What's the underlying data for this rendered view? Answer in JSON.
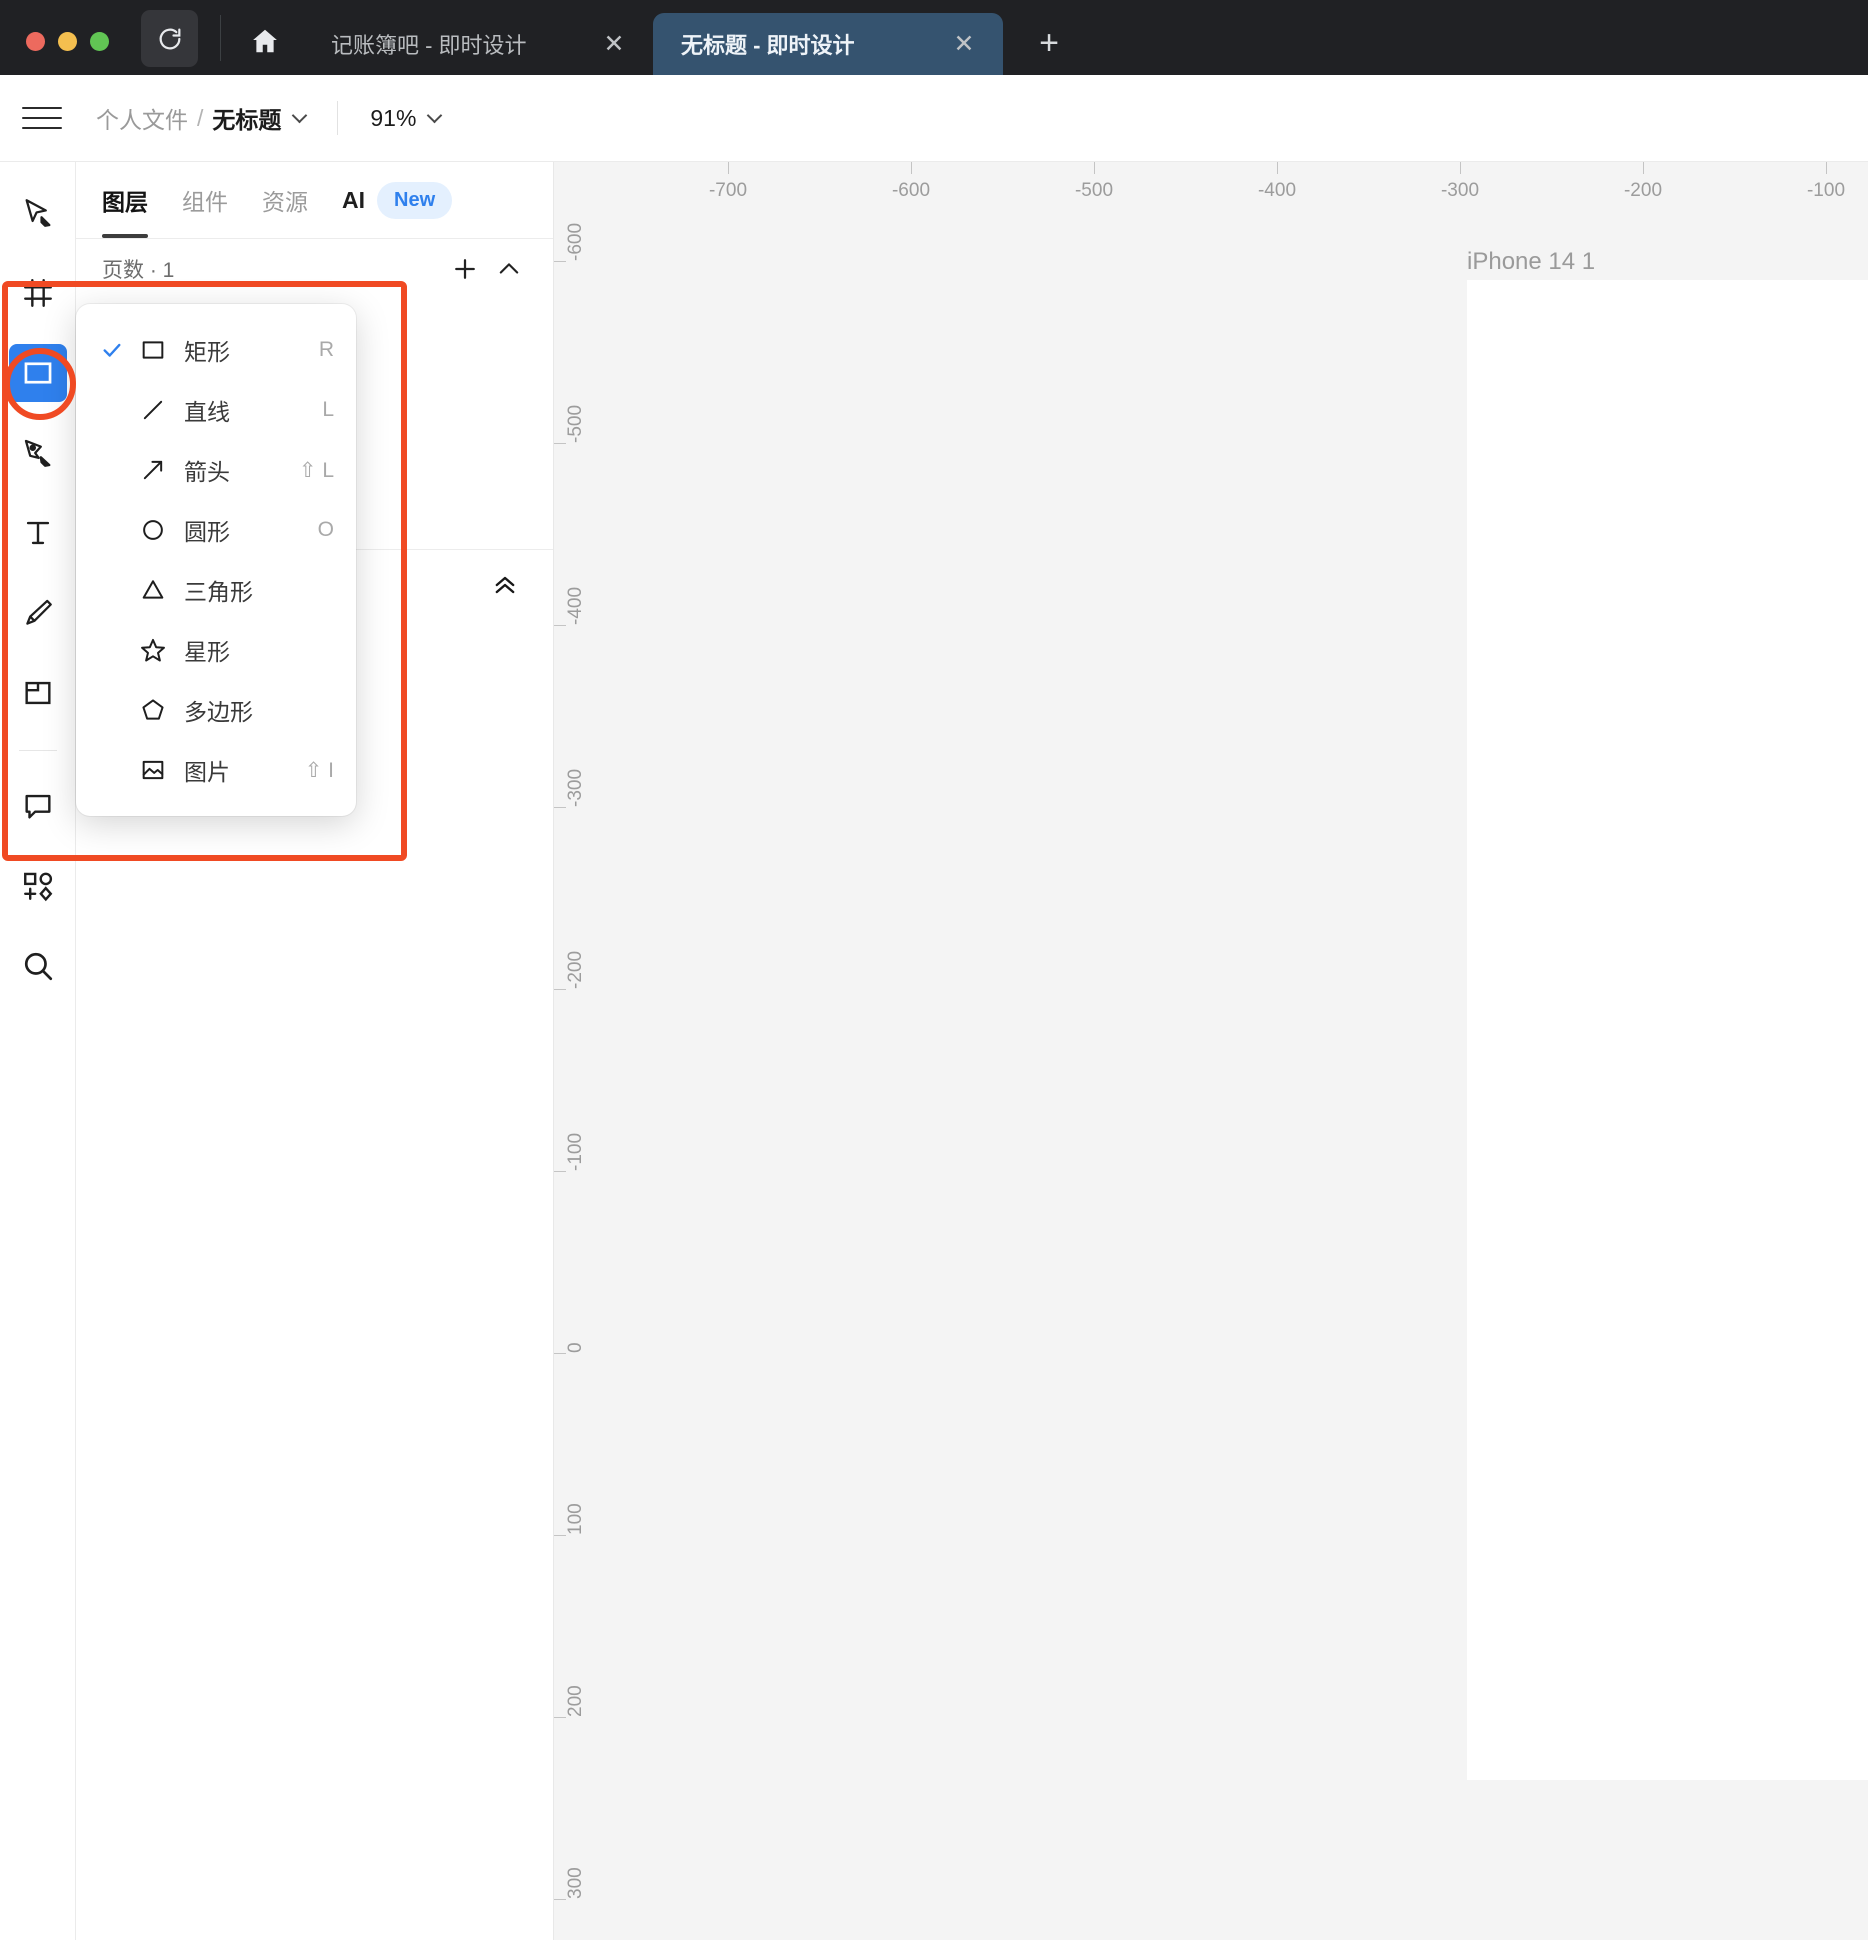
{
  "browser": {
    "reload_icon": "reload-icon",
    "home_icon": "home-icon",
    "new_tab_label": "+",
    "close_label": "✕",
    "tabs": [
      {
        "title": "记账簿吧 - 即时设计",
        "active": false
      },
      {
        "title": "无标题 - 即时设计",
        "active": true
      }
    ]
  },
  "toolbar": {
    "menu_icon": "hamburger-icon",
    "breadcrumb_folder": "个人文件",
    "breadcrumb_sep": "/",
    "breadcrumb_file": "无标题",
    "zoom_level": "91%"
  },
  "tool_rail": {
    "tools": [
      {
        "name": "cursor-tool",
        "icon": "cursor-icon",
        "active": false
      },
      {
        "name": "frame-tool",
        "icon": "frame-grid-icon",
        "active": false
      },
      {
        "name": "shape-tool",
        "icon": "rectangle-icon",
        "active": true
      },
      {
        "name": "pen-tool",
        "icon": "pen-nib-icon",
        "active": false
      },
      {
        "name": "text-tool",
        "icon": "text-T-icon",
        "active": false
      },
      {
        "name": "pencil-tool",
        "icon": "pencil-icon",
        "active": false
      },
      {
        "name": "slice-tool",
        "icon": "slice-icon",
        "active": false
      },
      {
        "name": "comment-tool",
        "icon": "comment-bubble-icon",
        "active": false
      },
      {
        "name": "component-tool",
        "icon": "component-add-icon",
        "active": false
      },
      {
        "name": "search-tool",
        "icon": "search-icon",
        "active": false
      }
    ]
  },
  "panel": {
    "tabs": [
      {
        "label": "图层",
        "active": true
      },
      {
        "label": "组件",
        "active": false
      },
      {
        "label": "资源",
        "active": false
      }
    ],
    "ai_label": "AI",
    "ai_badge": "New",
    "pages_label": "页数 · 1",
    "add_page_icon": "plus-icon",
    "collapse_icon": "chevron-up-icon",
    "layers_collapse_icon": "double-chevron-up-icon"
  },
  "shape_menu": {
    "items": [
      {
        "label": "矩形",
        "icon": "rectangle-icon",
        "shortcut": "R",
        "modifier": "",
        "checked": true
      },
      {
        "label": "直线",
        "icon": "line-icon",
        "shortcut": "L",
        "modifier": "",
        "checked": false
      },
      {
        "label": "箭头",
        "icon": "arrow-icon",
        "shortcut": "L",
        "modifier": "⇧",
        "checked": false
      },
      {
        "label": "圆形",
        "icon": "circle-icon",
        "shortcut": "O",
        "modifier": "",
        "checked": false
      },
      {
        "label": "三角形",
        "icon": "triangle-icon",
        "shortcut": "",
        "modifier": "",
        "checked": false
      },
      {
        "label": "星形",
        "icon": "star-icon",
        "shortcut": "",
        "modifier": "",
        "checked": false
      },
      {
        "label": "多边形",
        "icon": "pentagon-icon",
        "shortcut": "",
        "modifier": "",
        "checked": false
      },
      {
        "label": "图片",
        "icon": "image-icon",
        "shortcut": "I",
        "modifier": "⇧",
        "checked": false
      }
    ]
  },
  "canvas": {
    "artboard_label": "iPhone 14 1",
    "ruler_h_ticks": [
      "-700",
      "-600",
      "-500",
      "-400",
      "-300",
      "-200",
      "-100"
    ],
    "ruler_v_ticks": [
      "-600",
      "-500",
      "-400",
      "-300",
      "-200",
      "-100",
      "0",
      "100",
      "200",
      "300"
    ]
  },
  "annotations": {
    "accent_color": "#f04a23"
  }
}
